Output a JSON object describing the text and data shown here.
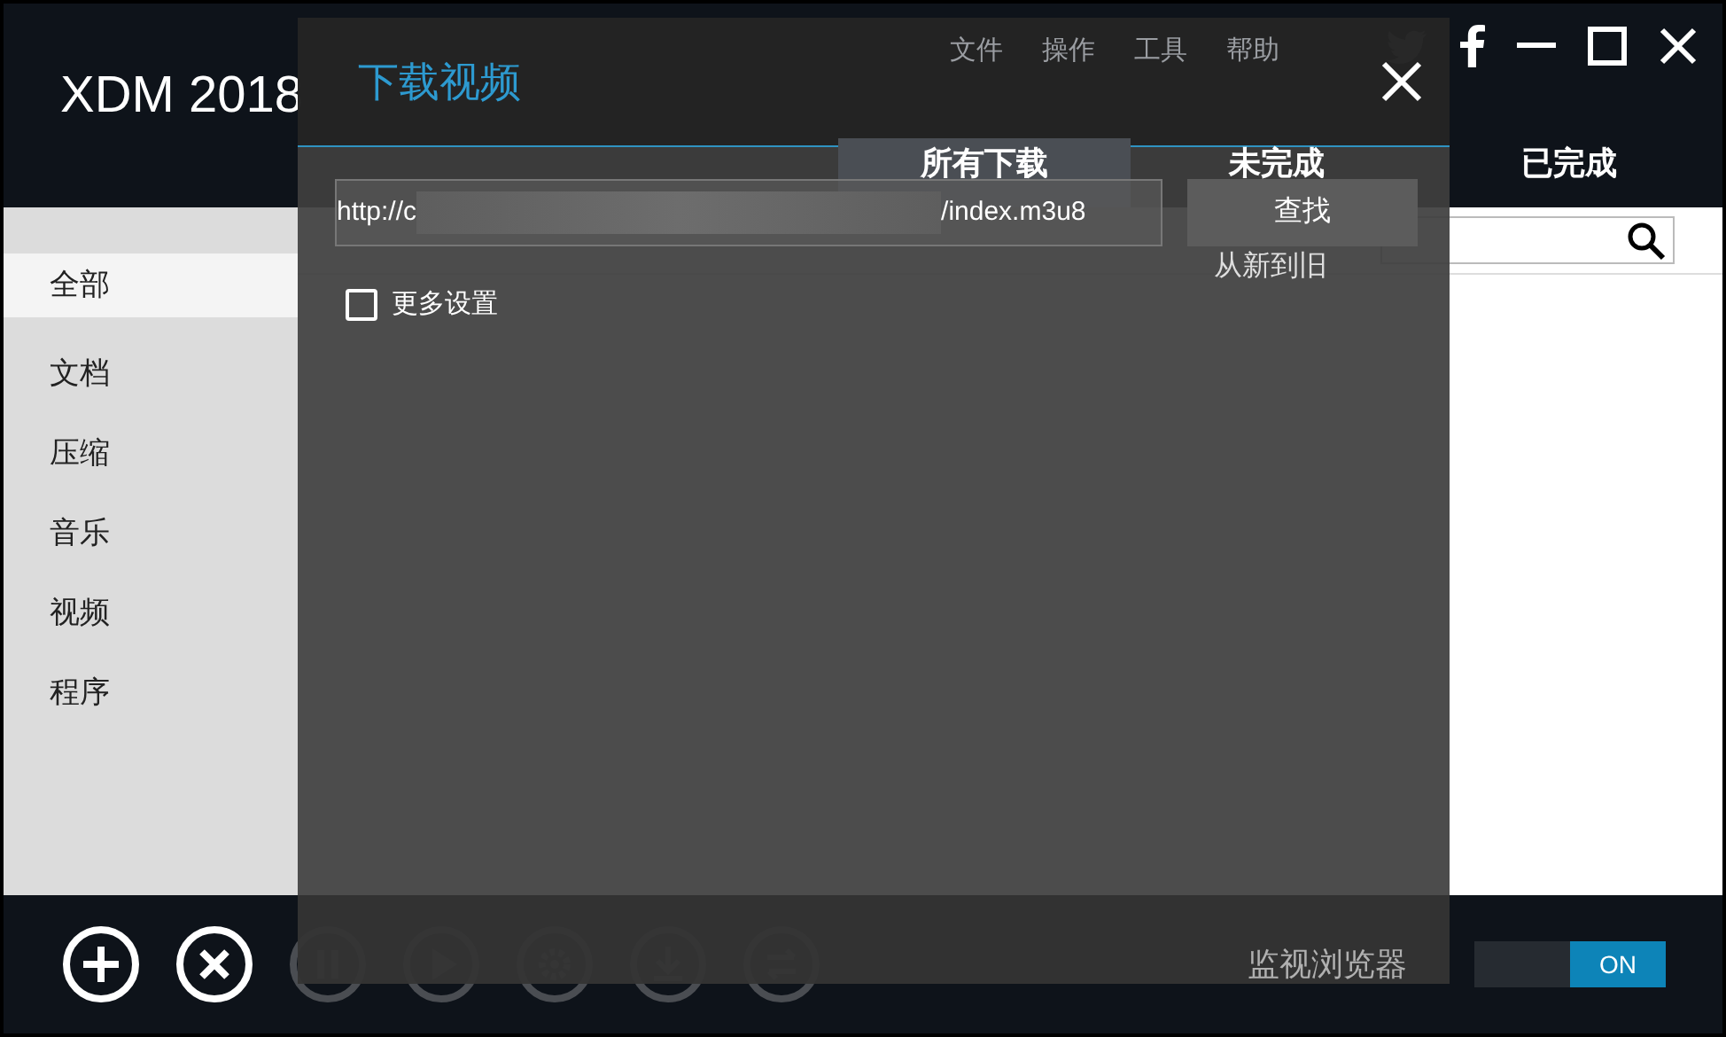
{
  "window": {
    "title": "XDM 2018"
  },
  "menu": [
    "文件",
    "操作",
    "工具",
    "帮助"
  ],
  "tabs": [
    {
      "label": "所有下载",
      "selected": true
    },
    {
      "label": "未完成",
      "selected": false
    },
    {
      "label": "已完成",
      "selected": false
    }
  ],
  "sort": {
    "label": "从新到旧"
  },
  "sidebar": {
    "items": [
      {
        "label": "全部",
        "selected": true
      },
      {
        "label": "文档",
        "selected": false
      },
      {
        "label": "压缩",
        "selected": false
      },
      {
        "label": "音乐",
        "selected": false
      },
      {
        "label": "视频",
        "selected": false
      },
      {
        "label": "程序",
        "selected": false
      }
    ]
  },
  "toolbar": [
    {
      "kind": "add",
      "disabled": false
    },
    {
      "kind": "cancel",
      "disabled": false
    },
    {
      "kind": "pause",
      "disabled": true
    },
    {
      "kind": "play",
      "disabled": true
    },
    {
      "kind": "settings",
      "disabled": true
    },
    {
      "kind": "download",
      "disabled": true
    },
    {
      "kind": "convert",
      "disabled": true
    }
  ],
  "monitor": {
    "label": "监视浏览器",
    "toggle": {
      "text": "ON",
      "on": true
    }
  },
  "dialog": {
    "title": "下载视频",
    "url_start": "http://c",
    "url_end": "/index.m3u8",
    "button": "查找",
    "more_settings": {
      "label": "更多设置",
      "checked": false
    }
  }
}
